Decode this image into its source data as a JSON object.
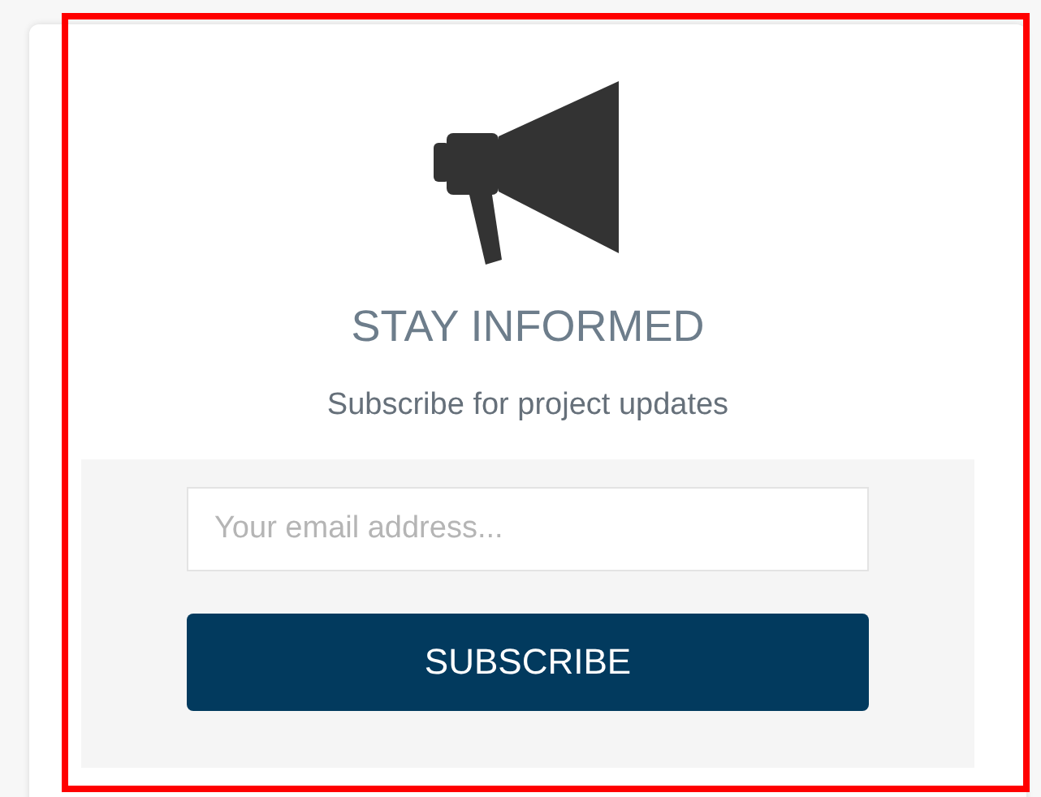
{
  "title": "STAY INFORMED",
  "subtitle": "Subscribe for project updates",
  "email": {
    "placeholder": "Your email address..."
  },
  "button": {
    "label": "SUBSCRIBE"
  }
}
